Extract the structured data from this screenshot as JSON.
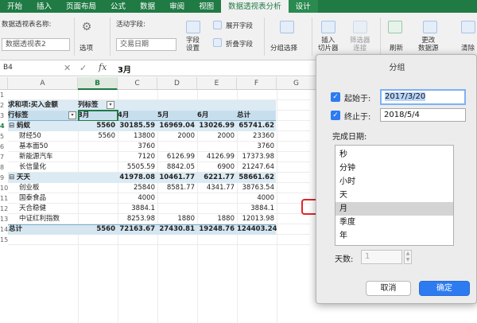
{
  "ribbon_tabs": [
    "开始",
    "插入",
    "页面布局",
    "公式",
    "数据",
    "审阅",
    "视图",
    "数据透视表分析",
    "设计"
  ],
  "ribbon": {
    "pivot_name_label": "数据透视表名称:",
    "pivot_name_value": "数据透视表2",
    "options_label": "选项",
    "active_field_label": "活动字段:",
    "active_field_value": "交易日期",
    "field_settings_label": "字段\n设置",
    "expand_field_label": "展开字段",
    "collapse_field_label": "折叠字段",
    "group_selection_label": "分组选择",
    "insert_slicer_label": "插入\n切片器",
    "filter_connections_label": "筛选器\n连接",
    "refresh_label": "刷新",
    "change_source_label": "更改\n数据源",
    "clear_label": "清除"
  },
  "formula_bar": {
    "name_box": "B4",
    "cancel_symbol": "✕",
    "enter_symbol": "✓",
    "fx": "fx",
    "value": "3月"
  },
  "sheet": {
    "columns": [
      "A",
      "B",
      "C",
      "D",
      "E",
      "F",
      "G"
    ],
    "rows": [
      "1",
      "2",
      "3",
      "4",
      "5",
      "6",
      "7",
      "8",
      "9",
      "10",
      "11",
      "12",
      "13",
      "14",
      "15"
    ],
    "pivot": {
      "header_label": "求和项:买入金额",
      "col_label_header": "列标签",
      "row_label_header": "行标签",
      "months": [
        "3月",
        "4月",
        "5月",
        "6月",
        "总计"
      ],
      "data_rows": [
        {
          "label": "蚂蚁",
          "indent": 0,
          "collapse": "⊟",
          "bold": true,
          "values": [
            "5560",
            "30185.59",
            "16969.04",
            "13026.99",
            "65741.62"
          ]
        },
        {
          "label": "财经50",
          "indent": 1,
          "values": [
            "5560",
            "13800",
            "2000",
            "2000",
            "23360"
          ]
        },
        {
          "label": "基本面50",
          "indent": 1,
          "values": [
            "",
            "3760",
            "",
            "",
            "3760"
          ]
        },
        {
          "label": "新能源汽车",
          "indent": 1,
          "values": [
            "",
            "7120",
            "6126.99",
            "4126.99",
            "17373.98"
          ]
        },
        {
          "label": "长信量化",
          "indent": 1,
          "values": [
            "",
            "5505.59",
            "8842.05",
            "6900",
            "21247.64"
          ]
        },
        {
          "label": "天天",
          "indent": 0,
          "collapse": "⊟",
          "bold": true,
          "values": [
            "",
            "41978.08",
            "10461.77",
            "6221.77",
            "58661.62"
          ]
        },
        {
          "label": "创业板",
          "indent": 1,
          "values": [
            "",
            "25840",
            "8581.77",
            "4341.77",
            "38763.54"
          ]
        },
        {
          "label": "国泰食品",
          "indent": 1,
          "values": [
            "",
            "4000",
            "",
            "",
            "4000"
          ]
        },
        {
          "label": "天合稳健",
          "indent": 1,
          "values": [
            "",
            "3884.1",
            "",
            "",
            "3884.1"
          ]
        },
        {
          "label": "中证红利指数",
          "indent": 1,
          "values": [
            "",
            "8253.98",
            "1880",
            "1880",
            "12013.98"
          ]
        },
        {
          "label": "总计",
          "indent": 0,
          "bold": true,
          "total": true,
          "values": [
            "5560",
            "72163.67",
            "27430.81",
            "19248.76",
            "124403.24"
          ]
        }
      ]
    }
  },
  "dialog": {
    "title": "分组",
    "start_label": "起始于:",
    "start_value": "2017/3/20",
    "end_label": "终止于:",
    "end_value": "2018/5/4",
    "group_by_label": "完成日期:",
    "options": [
      "秒",
      "分钟",
      "小时",
      "天",
      "月",
      "季度",
      "年"
    ],
    "selected_option": "月",
    "days_label": "天数:",
    "days_value": "1",
    "cancel_label": "取消",
    "ok_label": "确定",
    "checkmark": "✓",
    "spin_up": "▲",
    "spin_down": "▼"
  },
  "colors": {
    "ribbon_green": "#1f7a44",
    "pivot_header_blue": "#c7dfed",
    "dialog_blue": "#2d7bf0",
    "highlight_red": "#e0262b"
  }
}
